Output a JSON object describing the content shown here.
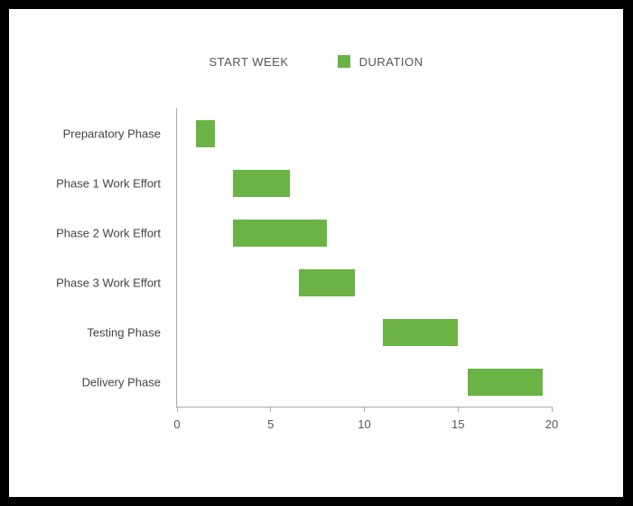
{
  "legend": {
    "start_label": "START WEEK",
    "duration_label": "DURATION"
  },
  "chart_data": {
    "type": "bar",
    "orientation": "horizontal",
    "stacked": true,
    "xlabel": "",
    "ylabel": "",
    "title": "",
    "xlim": [
      0,
      20
    ],
    "x_ticks": [
      0,
      5,
      10,
      15,
      20
    ],
    "categories": [
      "Preparatory Phase",
      "Phase 1 Work Effort",
      "Phase 2 Work Effort",
      "Phase 3 Work Effort",
      "Testing Phase",
      "Delivery Phase"
    ],
    "series": [
      {
        "name": "START WEEK",
        "values": [
          1,
          3,
          3,
          6.5,
          11,
          15.5
        ],
        "color": "transparent"
      },
      {
        "name": "DURATION",
        "values": [
          1,
          3,
          5,
          3,
          4,
          4
        ],
        "color": "#6ab344"
      }
    ],
    "legend_position": "top",
    "grid": false
  }
}
